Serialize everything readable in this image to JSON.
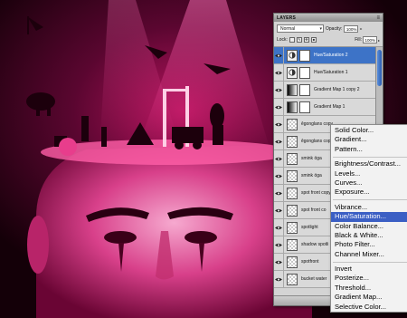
{
  "layers_panel": {
    "tab_label": "LAYERS",
    "blend_mode": "Normal",
    "opacity_label": "Opacity:",
    "opacity_value": "100%",
    "lock_label": "Lock:",
    "fill_label": "Fill:",
    "fill_value": "100%",
    "layers": [
      {
        "name": "Hue/Saturation 2",
        "kind": "adjustment",
        "selected": true
      },
      {
        "name": "Hue/Saturation 1",
        "kind": "adjustment",
        "selected": false
      },
      {
        "name": "Gradient Map 1 copy 2",
        "kind": "gradient",
        "selected": false
      },
      {
        "name": "Gradient Map 1",
        "kind": "gradient",
        "selected": false
      },
      {
        "name": "êgonglans copy",
        "kind": "pixel",
        "selected": false
      },
      {
        "name": "êgonglans copy",
        "kind": "pixel",
        "selected": false
      },
      {
        "name": "smink öga",
        "kind": "pixel",
        "selected": false
      },
      {
        "name": "smink öga",
        "kind": "pixel",
        "selected": false
      },
      {
        "name": "spot front copy",
        "kind": "pixel",
        "selected": false
      },
      {
        "name": "spot front co",
        "kind": "pixel",
        "selected": false
      },
      {
        "name": "spotlight",
        "kind": "pixel",
        "selected": false
      },
      {
        "name": "shadow spotli",
        "kind": "pixel",
        "selected": false
      },
      {
        "name": "spotfront",
        "kind": "pixel",
        "selected": false
      },
      {
        "name": "bucket water",
        "kind": "pixel",
        "selected": false
      }
    ]
  },
  "adjustment_menu": {
    "groups": [
      [
        "Solid Color...",
        "Gradient...",
        "Pattern..."
      ],
      [
        "Brightness/Contrast...",
        "Levels...",
        "Curves...",
        "Exposure..."
      ],
      [
        "Vibrance...",
        "Hue/Saturation...",
        "Color Balance...",
        "Black & White...",
        "Photo Filter...",
        "Channel Mixer..."
      ],
      [
        "Invert",
        "Posterize...",
        "Threshold...",
        "Gradient Map...",
        "Selective Color..."
      ]
    ],
    "highlighted": "Hue/Saturation..."
  },
  "colors": {
    "artwork_tint": "#e0157a",
    "selection_blue": "#3d73c7",
    "menu_highlight": "#3b5fc4"
  }
}
